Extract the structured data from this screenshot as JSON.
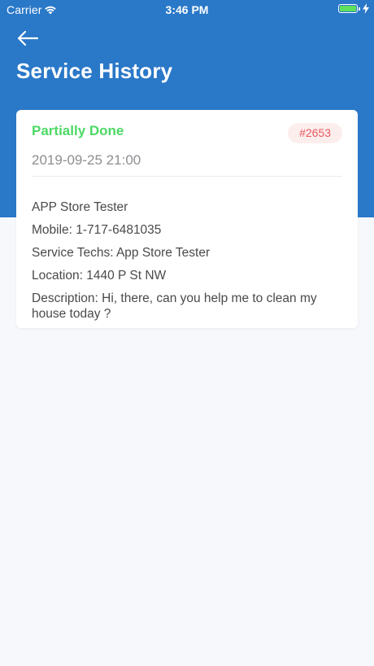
{
  "status_bar": {
    "carrier": "Carrier",
    "time": "3:46 PM"
  },
  "header": {
    "title": "Service History"
  },
  "card": {
    "status": "Partially Done",
    "order_id": "#2653",
    "datetime": "2019-09-25 21:00",
    "name": "APP Store Tester",
    "mobile": "Mobile: 1-717-6481035",
    "service_techs": "Service Techs: App Store  Tester",
    "location": "Location: 1440 P St NW",
    "description": "Description: Hi, there, can you help me to clean my house today ?"
  },
  "colors": {
    "header_bg": "#2a78c8",
    "page_bg": "#f7f8fb",
    "status_green": "#4cd964",
    "badge_bg": "#fdeeee",
    "badge_text": "#e8595d",
    "battery_green": "#5ee05c"
  },
  "icons": {
    "back": "arrow-left-icon",
    "wifi": "wifi-icon",
    "battery": "battery-icon",
    "charging": "bolt-icon"
  }
}
